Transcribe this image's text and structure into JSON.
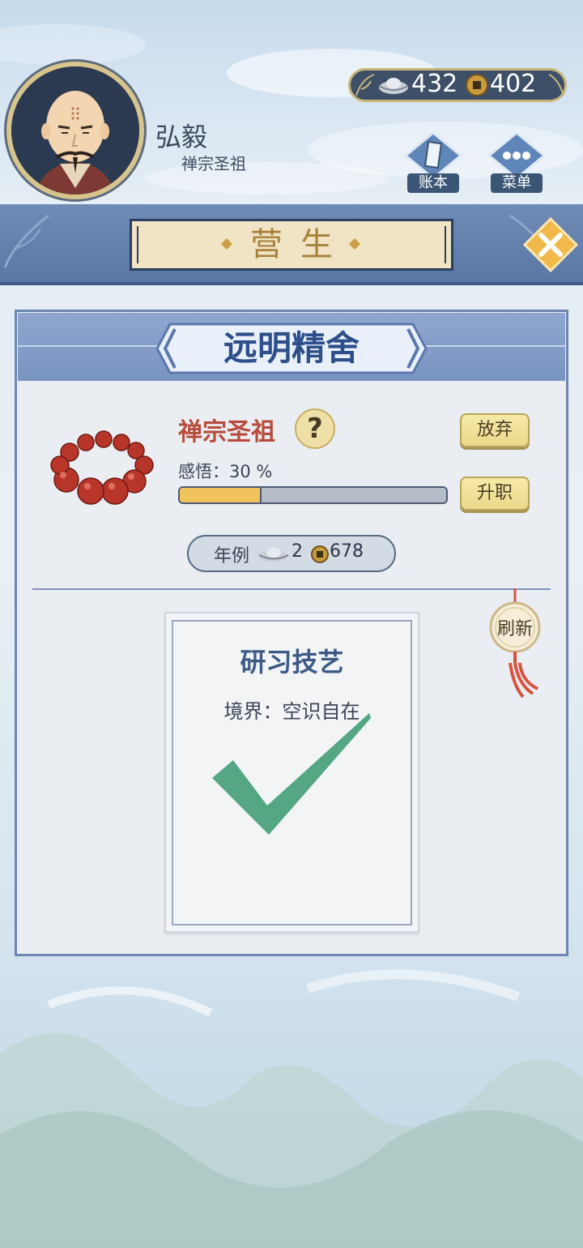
{
  "player": {
    "name": "弘毅",
    "title": "禅宗圣祖"
  },
  "currency": {
    "silver": "432",
    "copper": "402"
  },
  "top_buttons": {
    "ledger_label": "账本",
    "menu_label": "菜单"
  },
  "banner": {
    "title": "营生"
  },
  "card": {
    "title": "远明精舍",
    "position_title": "禅宗圣祖",
    "help_label": "?",
    "insight_text": "感悟：30 %",
    "insight_progress": 0.3,
    "abandon_label": "放弃",
    "promote_label": "升职",
    "salary": {
      "label": "年例",
      "silver": "2",
      "copper": "678"
    }
  },
  "task": {
    "title": "研习技艺",
    "realm": "境界：空识自在",
    "completed": true
  },
  "refresh_label": "刷新",
  "colors": {
    "accent_blue": "#6d86b2",
    "gold": "#c8b57a",
    "check_green": "#55a783",
    "position_red": "#b84c3c"
  }
}
